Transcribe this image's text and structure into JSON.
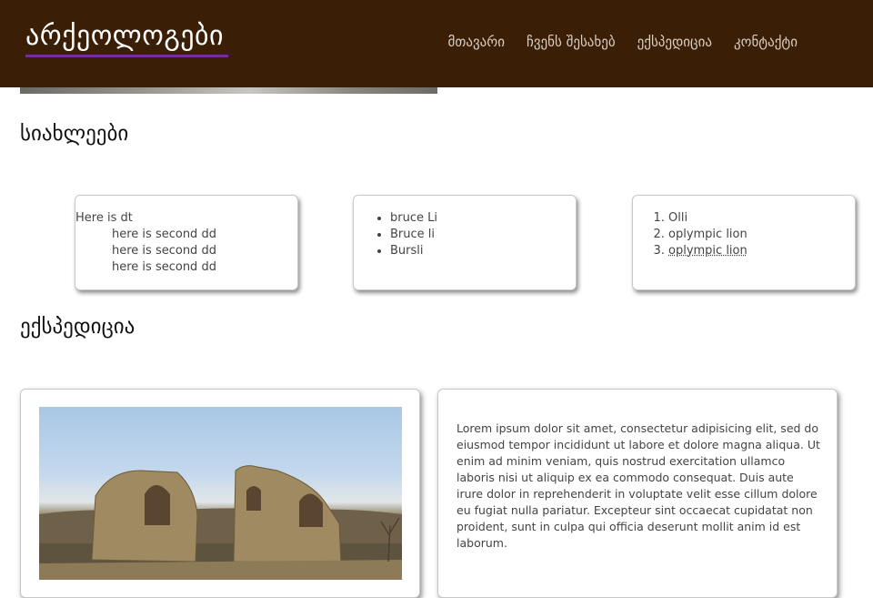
{
  "header": {
    "logo": "არქეოლოგები",
    "nav": [
      {
        "label": "მთავარი"
      },
      {
        "label": "ჩვენს შესახებ"
      },
      {
        "label": "ექსპედიცია"
      },
      {
        "label": "კონტაქტი"
      }
    ]
  },
  "news": {
    "title": "სიახლეები",
    "card1": {
      "dt": "Here is dt",
      "dd": [
        "here is second dd",
        "here is second dd",
        "here is second dd"
      ]
    },
    "card2": {
      "items": [
        "bruce Li",
        "Bruce li",
        "Bursli"
      ]
    },
    "card3": {
      "items": [
        "Olli",
        "oplympic lion",
        "oplympic lion"
      ]
    }
  },
  "expedition": {
    "title": "ექსპედიცია",
    "text": "Lorem ipsum dolor sit amet, consectetur adipisicing elit, sed do eiusmod tempor incididunt ut labore et dolore magna aliqua. Ut enim ad minim veniam, quis nostrud exercitation ullamco laboris nisi ut aliquip ex ea commodo consequat. Duis aute irure dolor in reprehenderit in voluptate velit esse cillum dolore eu fugiat nulla pariatur. Excepteur sint occaecat cupidatat non proident, sunt in culpa qui officia deserunt mollit anim id est laborum."
  },
  "colors": {
    "header_bg": "#3a1f06",
    "logo_underline": "#7a2a9a",
    "nav_text": "#d9cfc3"
  },
  "icons": [
    "ruins-photo"
  ]
}
